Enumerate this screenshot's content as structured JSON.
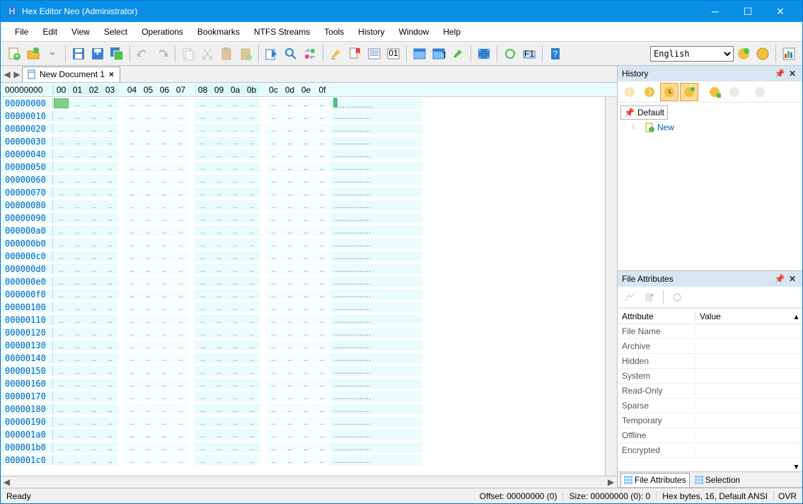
{
  "titlebar": {
    "title": "Hex Editor Neo (Administrator)"
  },
  "menu": [
    "File",
    "Edit",
    "View",
    "Select",
    "Operations",
    "Bookmarks",
    "NTFS Streams",
    "Tools",
    "History",
    "Window",
    "Help"
  ],
  "toolbar": {
    "language": "English"
  },
  "tab": {
    "name": "New Document 1"
  },
  "hex": {
    "header_addr": "00000000",
    "columns": [
      "00",
      "01",
      "02",
      "03",
      "04",
      "05",
      "06",
      "07",
      "08",
      "09",
      "0a",
      "0b",
      "0c",
      "0d",
      "0e",
      "0f"
    ],
    "rows": [
      "00000000",
      "00000010",
      "00000020",
      "00000030",
      "00000040",
      "00000050",
      "00000060",
      "00000070",
      "00000080",
      "00000090",
      "000000a0",
      "000000b0",
      "000000c0",
      "000000d0",
      "000000e0",
      "000000f0",
      "00000100",
      "00000110",
      "00000120",
      "00000130",
      "00000140",
      "00000150",
      "00000160",
      "00000170",
      "00000180",
      "00000190",
      "000001a0",
      "000001b0",
      "000001c0"
    ]
  },
  "history": {
    "title": "History",
    "default": "Default",
    "new": "New"
  },
  "attributes": {
    "title": "File Attributes",
    "hdr_attr": "Attribute",
    "hdr_val": "Value",
    "rows": [
      "File Name",
      "Archive",
      "Hidden",
      "System",
      "Read-Only",
      "Sparse",
      "Temporary",
      "Offline",
      "Encrypted"
    ]
  },
  "panel_tabs": {
    "file_attrs": "File Attributes",
    "selection": "Selection"
  },
  "status": {
    "ready": "Ready",
    "offset": "Offset: 00000000 (0)",
    "size": "Size: 00000000 (0): 0",
    "type": "Hex bytes, 16, Default ANSI",
    "ovr": "OVR"
  }
}
